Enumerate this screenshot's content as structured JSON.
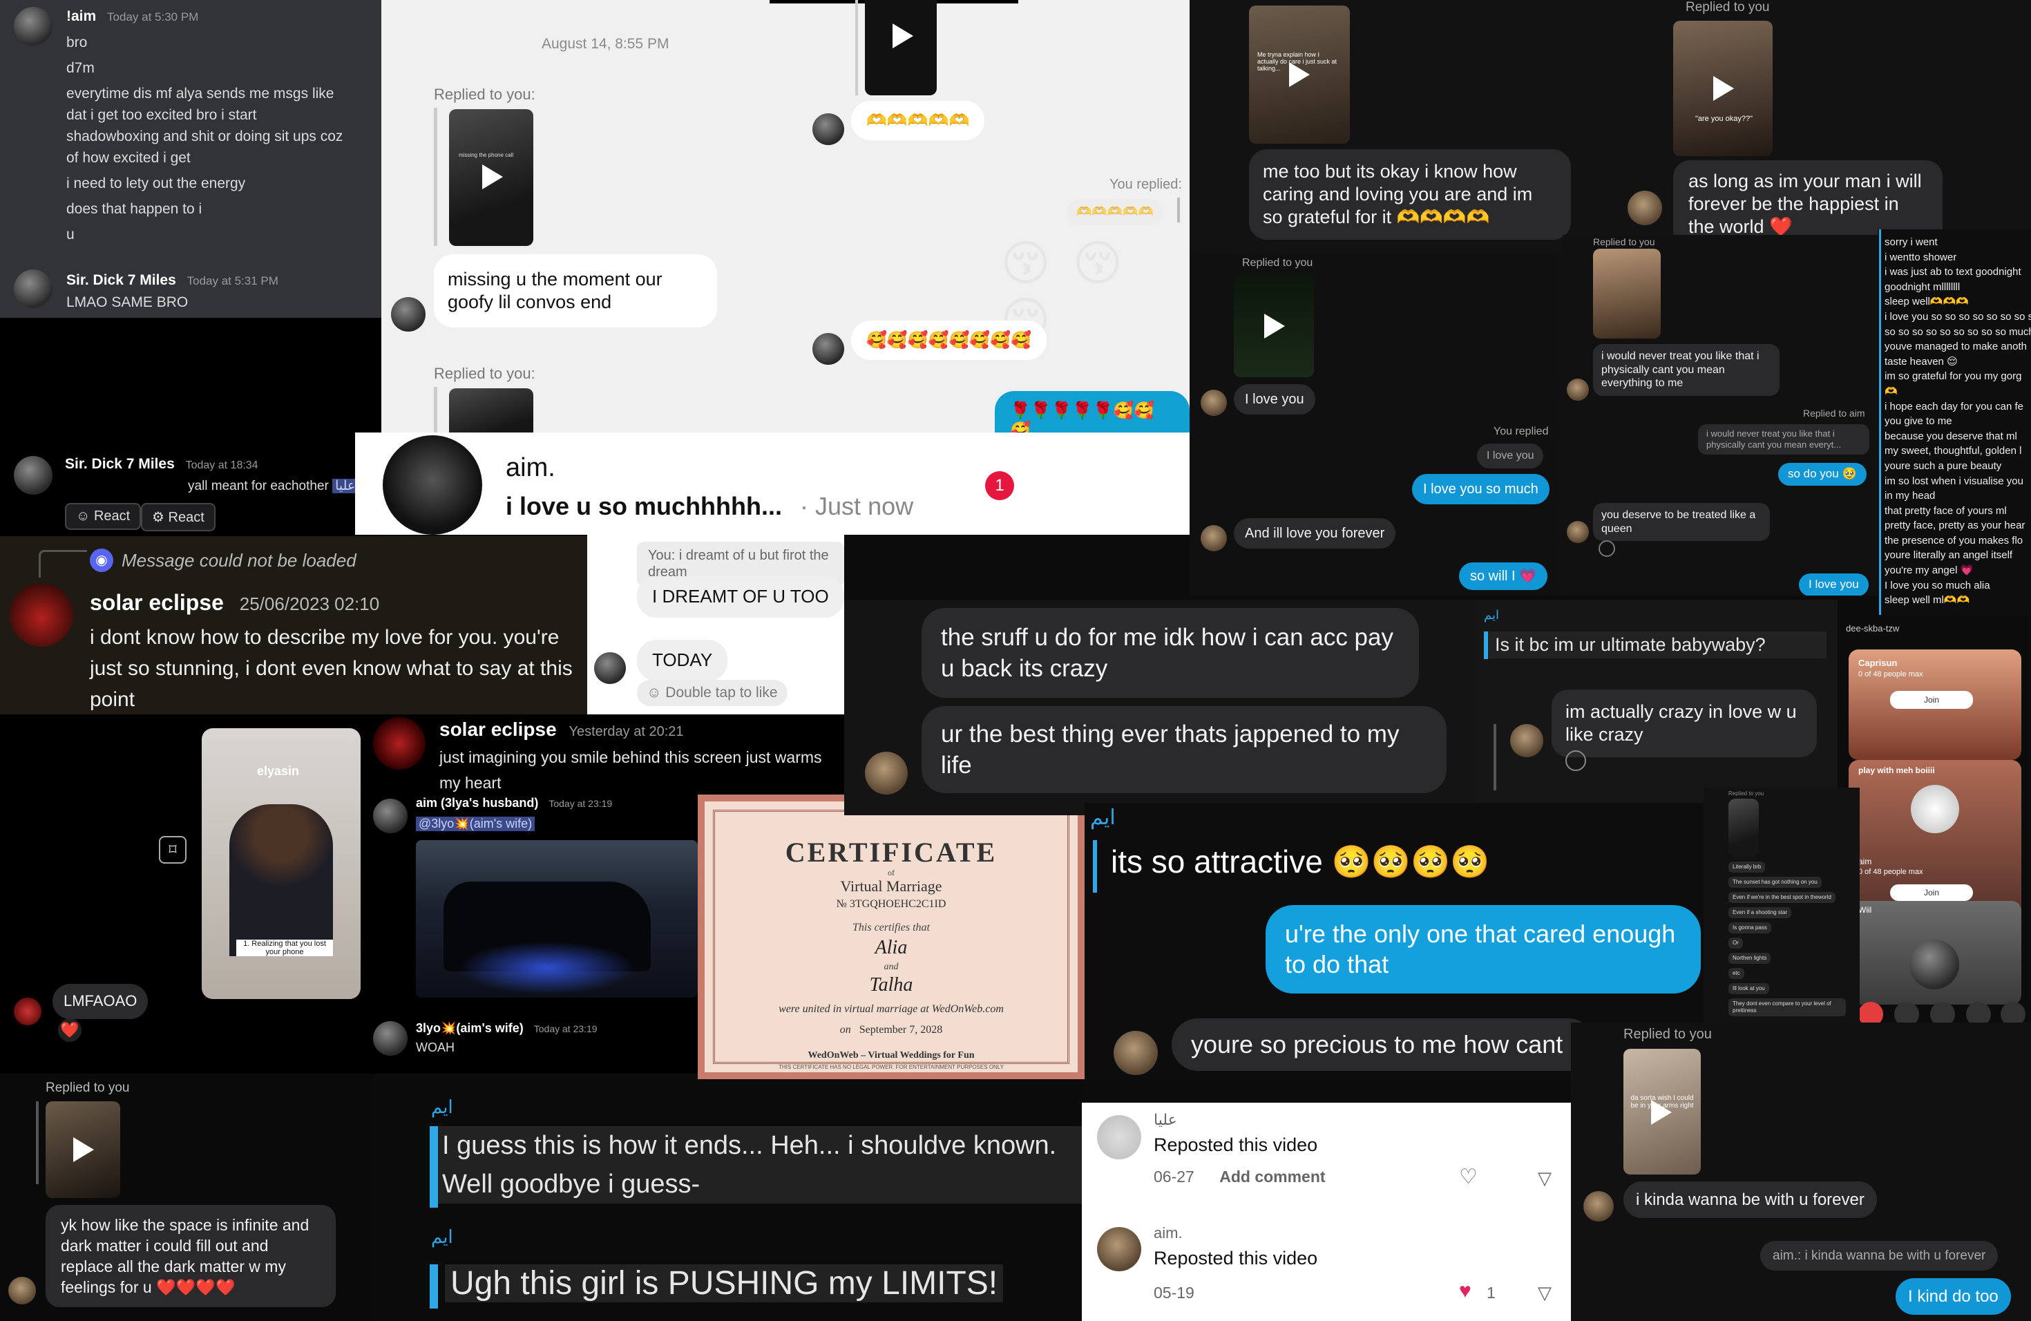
{
  "discord1": {
    "name": "!aim",
    "time": "Today at 5:30 PM",
    "lines": [
      "bro",
      "d7m",
      "everytime dis mf alya sends me msgs like",
      "dat i get too excited bro i start",
      "shadowboxing and shit or doing sit ups coz",
      "of how excited i get",
      "i need to lety out the energy",
      "does that happen to i",
      "u"
    ],
    "name2": "Sir. Dick 7 Miles",
    "time2": "Today at 5:31 PM",
    "msg2": "LMAO SAME BRO"
  },
  "discord2": {
    "name": "Sir. Dick 7 Miles",
    "time": "Today at 18:34",
    "msg": "yall meant for eachother",
    "mention": "عليا",
    "react1": "React",
    "react2": "React"
  },
  "ig1": {
    "date": "August 14, 8:55 PM",
    "replied": "Replied to you:",
    "thumb_caption": "missing the phone call",
    "msg": "missing u the moment our goofy lil convos end",
    "replied2": "Replied to you:",
    "you_replied": "You replied:",
    "emoji_reply": "🫶🫶🫶🫶🫶",
    "emoji_row1": "🫶🫶🫶🫶🫶",
    "kiss": "😚 😚 😚",
    "faces": "🥰🥰🥰🥰🥰🥰🥰🥰",
    "roses": "🌹🌹🌹🌹🌹🥰🥰🥰"
  },
  "notif": {
    "name": "aim.",
    "msg": "i love u so muchhhhh...",
    "time": "· Just now",
    "badge": "1"
  },
  "dm2": {
    "quote": "You: i dreamt of u but firot the dream",
    "msg1": "I DREAMT OF U TOO",
    "msg2": "TODAY",
    "hint": "Double tap to like"
  },
  "discord3": {
    "unloaded": "Message could not be loaded",
    "name": "solar eclipse",
    "time": "25/06/2023 02:10",
    "msg": "i dont know how to describe my love for you. you're just so stunning, i dont even know what to say at this point"
  },
  "ig2": {
    "thumb_caption": "Me tryna explain how I actually do care i just suck at talking...",
    "msg": "me too but its okay i know how caring and loving you are and im so grateful for it 🫶🫶🫶🫶"
  },
  "ig3": {
    "replied": "Replied to you",
    "thumb_caption": "\"are you okay??\"",
    "msg": "as long as im your man i will forever be the happiest in the world ❤️"
  },
  "chat4": {
    "replied": "Replied to you",
    "msg1": "I love you",
    "you_replied": "You replied",
    "quote": "I love you",
    "msg2": "I love you so much",
    "msg3": "And ill love you forever",
    "msg4": "so will I 💗"
  },
  "chat5": {
    "replied": "Replied to you",
    "msg1": "i would never treat you like that i physically cant you mean everything to me",
    "replied_aim": "Replied to aim",
    "quote": "i would never treat you like that i physically cant you mean everyt...",
    "msg2": "so do you 🥹",
    "msg3": "you deserve to be treated like a queen",
    "msg4": "I love you"
  },
  "notes": {
    "lines": [
      "sorry i went",
      "i wentto shower",
      "i was just ab to text goodnight",
      "goodnight mllllllll",
      "sleep well🫶🫶🫶",
      "i love you so so so so so so so so",
      "so so so so so so so so so much",
      "youve managed to make anoth",
      "taste heaven 😌",
      "im so grateful for you my gorg",
      "🫶",
      "i hope each day for you can fe",
      "you give to me",
      "because you deserve that ml",
      "my sweet, thoughtful, golden l",
      "youre such a pure beauty",
      "im so lost when i visualise you",
      "in my head",
      "that pretty face of yours ml",
      "pretty face, pretty as your hear",
      "the presence of you makes flo",
      "youre literally an angel itself",
      "you're my angel 💗",
      "I love you so much alia",
      "sleep well ml🫶🫶"
    ]
  },
  "chat6": {
    "msg1": "the sruff u do for me idk how i can acc pay u back its crazy",
    "msg2": "ur the best thing ever thats jappened to my life"
  },
  "chat7": {
    "sender": "ايم",
    "quote": "Is it bc im ur ultimate babywaby?",
    "msg": "im actually crazy in love w u like crazy"
  },
  "stream": {
    "header": "dee-skba-tzw",
    "card1_title": "Caprisun",
    "card1_sub": "0 of 48 people max",
    "join": "Join",
    "card2_title": "play with meh boiiii",
    "card2_name": "aim",
    "card2_sub": "0 of 48 people max",
    "join2": "Join",
    "card3": "Wiil"
  },
  "story": {
    "handle": "elyasin",
    "caption": "1. Realizing that you lost your phone"
  },
  "chat8": {
    "name": "solar eclipse",
    "time": "Yesterday at 20:21",
    "msg": "just imagining you smile behind this screen just warms my heart"
  },
  "chat9": {
    "name": "aim (3lya's husband)",
    "time": "Today at 23:19",
    "mention": "@3lyo💥(aim's wife)",
    "name2": "3lyo💥(aim's wife)",
    "time2": "Today at 23:19",
    "msg2": "WOAH"
  },
  "chat10": {
    "msg": "LMFAOAO",
    "react": "❤️"
  },
  "cert": {
    "title": "CERTIFICATE",
    "of": "of",
    "sub": "Virtual Marriage",
    "num": "№ 3TGQHOEHC2C1ID",
    "certifies": "This certifies that",
    "name1": "Alia",
    "and": "and",
    "name2": "Talha",
    "united": "were united in virtual marriage at WedOnWeb.com",
    "on": "on",
    "date": "September 7, 2028",
    "footer": "WedOnWeb – Virtual Weddings for Fun",
    "fine": "THIS CERTIFICATE HAS NO LEGAL POWER. FOR ENTERTAINMENT PURPOSES ONLY"
  },
  "chat11": {
    "sender": "ايم",
    "msg": "its so attractive 🥺🥺🥺🥺",
    "msg2": "u're the only one that cared enough to do that",
    "msg3": "youre so precious to me how cant i"
  },
  "mini": {
    "replied": "Replied to you",
    "lines": [
      "Literally brb",
      "The sunset has got nothing on you",
      "Even if we're in the best spot in theworld",
      "Even if a shooting star",
      "Is gonna pass",
      "Or",
      "Northen lights",
      "etc",
      "Ill look at you",
      "They dont even compare to your level of prettiness"
    ]
  },
  "chat12": {
    "replied": "Replied to you",
    "thumb_caption": "da sorta wish I could be in your arms right now",
    "msg": "i kinda wanna be with u forever",
    "quote": "aim.: i kinda wanna be with u forever",
    "msg2": "I kind do too"
  },
  "chat13": {
    "replied": "Replied to you",
    "msg": "yk how like the space is infinite and dark matter i could fill out and replace all the dark matter w my feelings for u ❤️❤️❤️❤️"
  },
  "chat14": {
    "sender": "ايم",
    "msg": "I guess this is how it ends... Heh... i shouldve known. Well goodbye i guess-",
    "sender2": "ايم",
    "msg2": "Ugh this girl is PUSHING my LIMITS!"
  },
  "tiktok": {
    "user1": "عليا",
    "repost1": "Reposted this video",
    "date1": "06-27",
    "add": "Add comment",
    "user2": "aim.",
    "repost2": "Reposted this video",
    "date2": "05-19",
    "likes2": "1"
  }
}
